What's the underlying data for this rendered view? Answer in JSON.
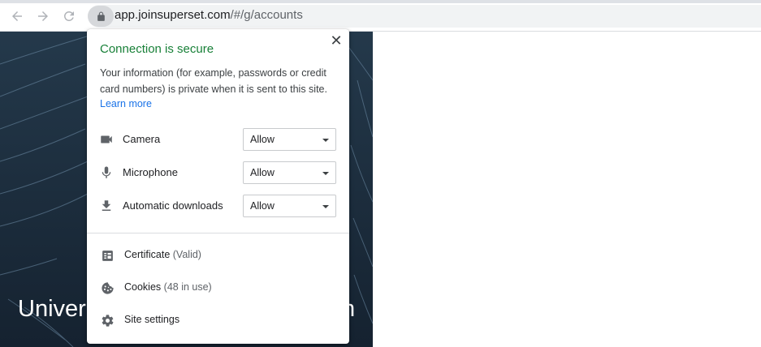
{
  "browser": {
    "url_host": "app.joinsuperset.com",
    "url_path": "/#/g/accounts",
    "back_icon": "back-arrow-icon",
    "forward_icon": "forward-arrow-icon",
    "reload_icon": "reload-icon",
    "lock_icon": "lock-icon"
  },
  "page": {
    "hero_text_start": "Univer",
    "hero_text_end": "n"
  },
  "popup": {
    "title": "Connection is secure",
    "description": "Your information (for example, passwords or credit card numbers) is private when it is sent to this site.",
    "learn_more": "Learn more",
    "close_glyph": "✕",
    "permissions": [
      {
        "label": "Camera",
        "value": "Allow",
        "icon": "camera-icon"
      },
      {
        "label": "Microphone",
        "value": "Allow",
        "icon": "microphone-icon"
      },
      {
        "label": "Automatic downloads",
        "value": "Allow",
        "icon": "download-icon"
      }
    ],
    "info_rows": [
      {
        "label": "Certificate",
        "sub": "(Valid)",
        "icon": "certificate-icon"
      },
      {
        "label": "Cookies",
        "sub": "(48 in use)",
        "icon": "cookie-icon"
      },
      {
        "label": "Site settings",
        "sub": "",
        "icon": "gear-icon"
      }
    ]
  },
  "colors": {
    "secure_green": "#188038",
    "link_blue": "#1a73e8",
    "hero_bg": "#1c2a38"
  }
}
